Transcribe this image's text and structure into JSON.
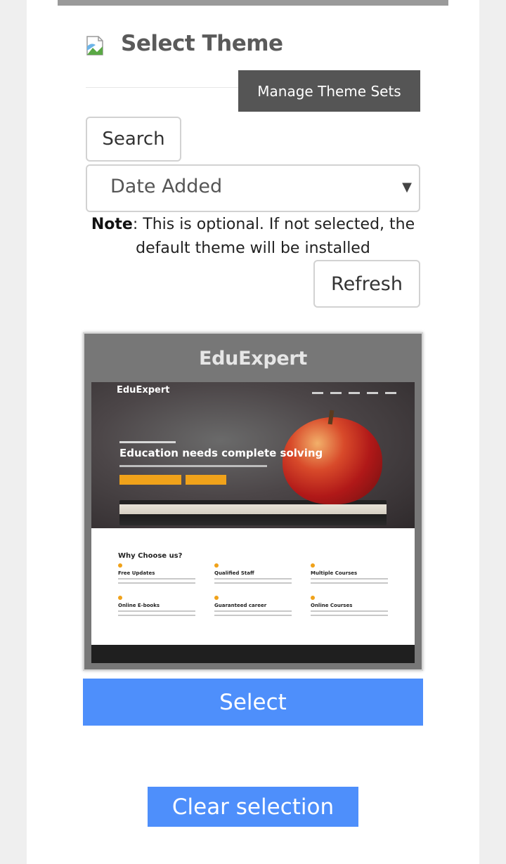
{
  "header": {
    "title": "Select Theme",
    "title_icon": "broken-image-icon",
    "manage_button": "Manage Theme Sets"
  },
  "filters": {
    "search_button": "Search",
    "sort_selected": "Date Added"
  },
  "note": {
    "label": "Note",
    "text": ": This is optional. If not selected, the default theme will be installed"
  },
  "refresh_button": "Refresh",
  "theme_card": {
    "name": "EduExpert",
    "preview": {
      "logo": "EduExpert",
      "headline": "Education needs complete solving",
      "section_title": "Why Choose us?",
      "features": [
        "Free Updates",
        "Qualified Staff",
        "Multiple Courses",
        "Online E-books",
        "Guaranteed career",
        "Online Courses"
      ]
    },
    "select_button": "Select"
  },
  "clear_button": "Clear selection",
  "colors": {
    "accent": "#4e8ffb",
    "dark_button": "#555555",
    "card_bg": "#777777"
  }
}
